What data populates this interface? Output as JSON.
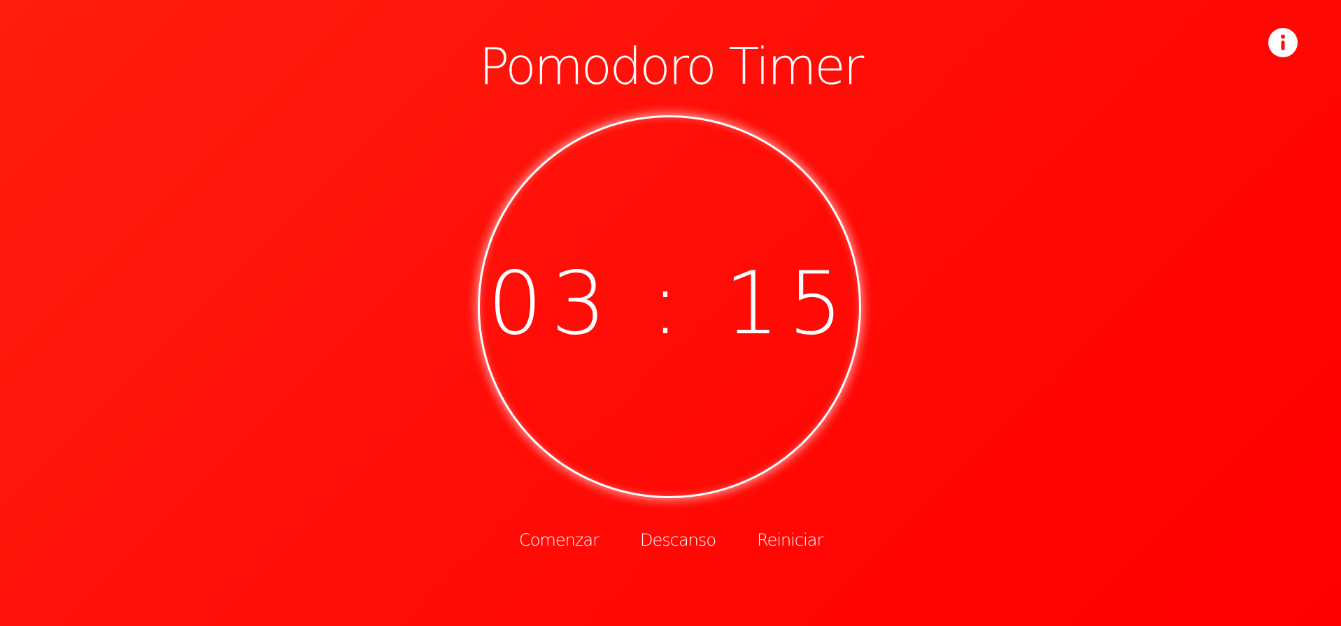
{
  "header": {
    "title": "Pomodoro Timer",
    "info_icon": "info-icon"
  },
  "timer": {
    "display": "03 : 15"
  },
  "controls": {
    "start_label": "Comenzar",
    "break_label": "Descanso",
    "reset_label": "Reiniciar"
  },
  "colors": {
    "background_start": "#ff1e10",
    "background_end": "#ff0000",
    "foreground": "#ffffff",
    "icon_glyph": "#ff0a05"
  }
}
